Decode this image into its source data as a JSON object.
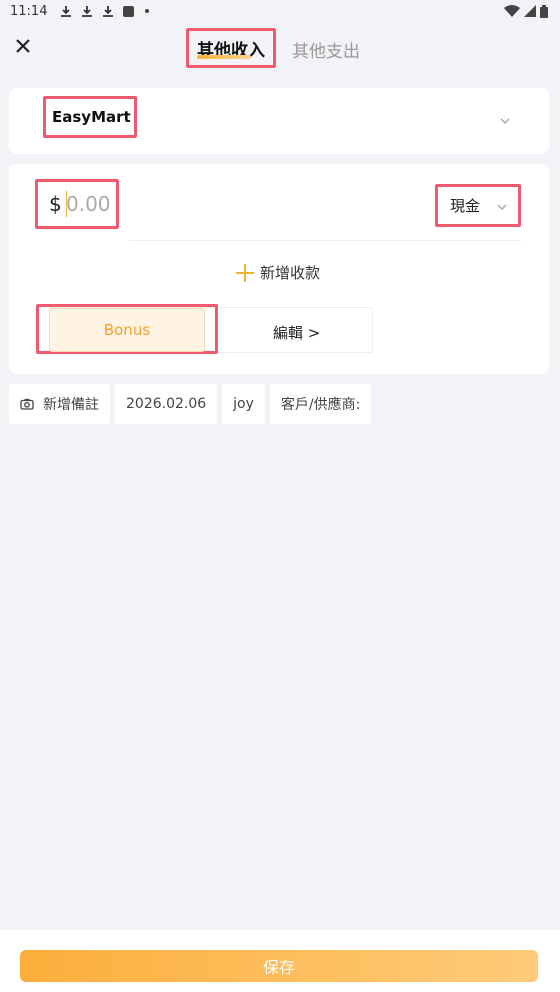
{
  "status_bar": {
    "time": "11:14"
  },
  "header": {
    "tabs": [
      {
        "label": "其他收入",
        "active": true
      },
      {
        "label": "其他支出",
        "active": false
      }
    ]
  },
  "store": {
    "name": "EasyMart"
  },
  "amount": {
    "currency_symbol": "$",
    "placeholder": "0.00",
    "payment_method": "現金"
  },
  "add_payment_label": "新增收款",
  "tags": [
    {
      "label": "Bonus",
      "selected": true
    }
  ],
  "edit_label": "編輯 >",
  "chips": {
    "note": "新增備註",
    "date": "2026.02.06",
    "user": "joy",
    "customer": "客戶/供應商:"
  },
  "save_label": "保存",
  "colors": {
    "accent": "#f5b130",
    "highlight": "#f05a6e",
    "background": "#f2f3f7"
  }
}
